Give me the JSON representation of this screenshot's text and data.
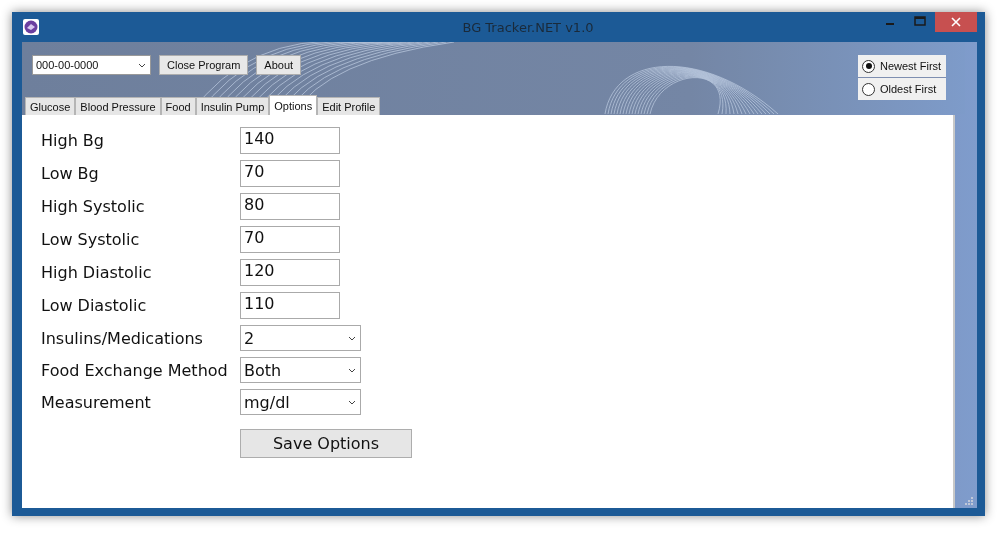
{
  "window": {
    "title": "BG Tracker.NET v1.0"
  },
  "toolbar": {
    "patient": "000-00-0000",
    "buttons": [
      "Close Program",
      "About"
    ]
  },
  "sort": [
    {
      "label": "Newest First",
      "selected": true
    },
    {
      "label": "Oldest First",
      "selected": false
    }
  ],
  "tabs": [
    {
      "label": "Glucose",
      "selected": false
    },
    {
      "label": "Blood Pressure",
      "selected": false
    },
    {
      "label": "Food",
      "selected": false
    },
    {
      "label": "Insulin Pump",
      "selected": false
    },
    {
      "label": "Options",
      "selected": true
    },
    {
      "label": "Edit Profile",
      "selected": false
    }
  ],
  "options": [
    {
      "label": "High Bg",
      "kind": "text",
      "value": "140"
    },
    {
      "label": "Low Bg",
      "kind": "text",
      "value": "70"
    },
    {
      "label": "High Systolic",
      "kind": "text",
      "value": "80"
    },
    {
      "label": "Low Systolic",
      "kind": "text",
      "value": "70"
    },
    {
      "label": "High Diastolic",
      "kind": "text",
      "value": "120"
    },
    {
      "label": "Low Diastolic",
      "kind": "text",
      "value": "110"
    },
    {
      "label": "Insulins/Medications",
      "kind": "select",
      "value": "2"
    },
    {
      "label": "Food Exchange Method",
      "kind": "select",
      "value": "Both"
    },
    {
      "label": "Measurement",
      "kind": "select",
      "value": "mg/dl"
    }
  ],
  "save_button": "Save Options"
}
